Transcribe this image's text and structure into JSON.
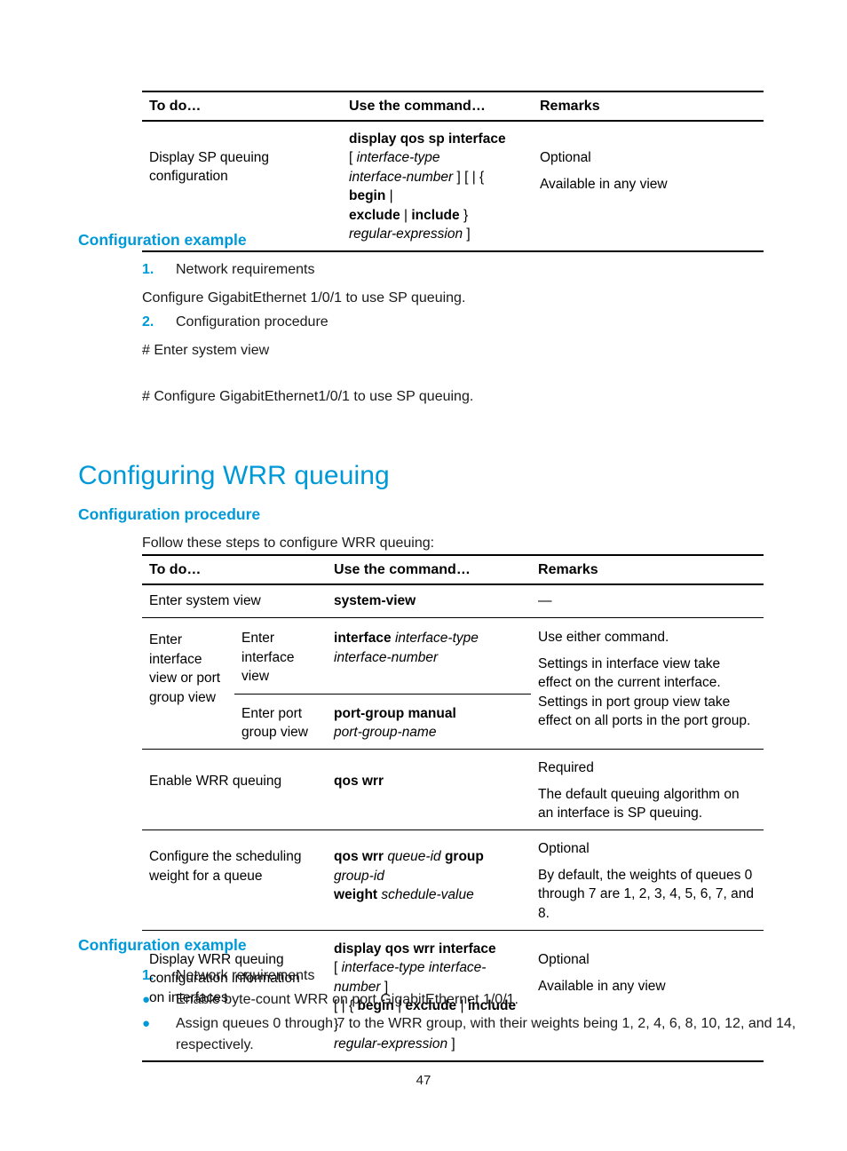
{
  "accent_color": "#0099d8",
  "page_number": "47",
  "table_sp": {
    "headers": [
      "To do…",
      "Use the command…",
      "Remarks"
    ],
    "rows": [
      {
        "todo": "Display SP queuing configuration",
        "command_lines": [
          {
            "text": "display qos sp interface",
            "style": "bold"
          },
          {
            "text": "[ interface-type",
            "style": "mixed-bracket-italic"
          },
          {
            "text": "interface-number ] [ | { begin |",
            "style": "mixed"
          },
          {
            "text": "exclude | include }",
            "style": "bold-pipes"
          },
          {
            "text": "regular-expression ]",
            "style": "italic-bracket"
          }
        ],
        "remarks": [
          "Optional",
          "Available in any view"
        ]
      }
    ]
  },
  "sp_example": {
    "heading": "Configuration example",
    "item1_num": "1.",
    "item1_text": "Network requirements",
    "para1": "Configure GigabitEthernet 1/0/1 to use SP queuing.",
    "item2_num": "2.",
    "item2_text": "Configuration procedure",
    "para2": "# Enter system view",
    "para3": "# Configure GigabitEthernet1/0/1 to use SP queuing."
  },
  "wrr_section": {
    "title": "Configuring WRR queuing",
    "procedure_heading": "Configuration procedure",
    "intro": "Follow these steps to configure WRR queuing:"
  },
  "table_wrr": {
    "headers": [
      "To do…",
      "Use the command…",
      "Remarks"
    ],
    "row_system_view": {
      "todo": "Enter system view",
      "command": "system-view",
      "remarks": "—"
    },
    "row_interface": {
      "todo": "Enter interface view or port group view",
      "sub_a_todo": "Enter interface view",
      "sub_a_cmd_bold": "interface",
      "sub_a_cmd_italic1": "interface-type",
      "sub_a_cmd_italic2": "interface-number",
      "sub_b_todo": "Enter port group view",
      "sub_b_cmd_bold": "port-group manual",
      "sub_b_cmd_italic": "port-group-name",
      "remarks_l1": "Use either command.",
      "remarks_l2": "Settings in interface view take effect on the current interface. Settings in port group view take effect on all ports in the port group."
    },
    "row_enable": {
      "todo": "Enable WRR queuing",
      "command": "qos wrr",
      "remarks_l1": "Required",
      "remarks_l2": "The default queuing algorithm on an interface is SP queuing."
    },
    "row_weight": {
      "todo": "Configure the scheduling weight for a queue",
      "cmd_b1": "qos wrr",
      "cmd_i1": "queue-id",
      "cmd_b2": "group",
      "cmd_i2": "group-id",
      "cmd_b3": "weight",
      "cmd_i3": "schedule-value",
      "remarks_l1": "Optional",
      "remarks_l2": "By default, the weights of queues 0 through 7 are 1, 2, 3, 4, 5, 6, 7, and 8."
    },
    "row_display": {
      "todo": "Display WRR queuing configuration information on interfaces",
      "cmd_l1": "display qos wrr interface",
      "cmd_l2": "[ interface-type interface-number ]",
      "cmd_l3": "[ | { begin | exclude | include }",
      "cmd_l4": "regular-expression ]",
      "remarks_l1": "Optional",
      "remarks_l2": "Available in any view"
    }
  },
  "wrr_example": {
    "heading": "Configuration example",
    "item1_num": "1.",
    "item1_text": "Network requirements",
    "bullet1": "Enable byte-count WRR on port GigabitEthernet 1/0/1.",
    "bullet2": "Assign queues 0 through 7 to the WRR group, with their weights being 1, 2, 4, 6, 8, 10, 12, and 14, respectively.",
    "bullet_glyph": "●"
  }
}
